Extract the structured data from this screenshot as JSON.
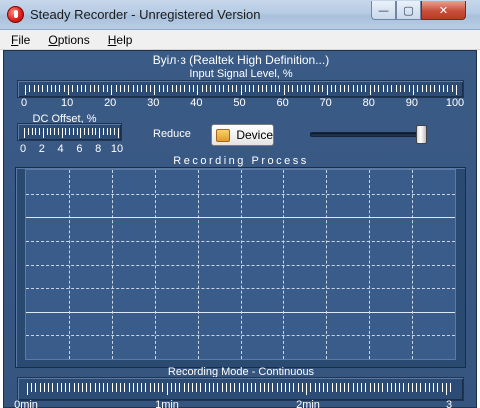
{
  "window": {
    "title": "Steady Recorder - Unregistered Version",
    "controls": {
      "minimize": "—",
      "maximize": "▢",
      "close": "✕"
    }
  },
  "menu": [
    "File",
    "Options",
    "Help"
  ],
  "device_label": "Вуiл·з (Realtek High Definition...)",
  "input_level": {
    "title": "Input Signal Level, %",
    "ticks": [
      "0",
      "10",
      "20",
      "30",
      "40",
      "50",
      "60",
      "70",
      "80",
      "90",
      "100"
    ]
  },
  "dc_offset": {
    "title": "DC Offset, %",
    "ticks": [
      "0",
      "2",
      "4",
      "6",
      "8",
      "10"
    ]
  },
  "reduce": {
    "label": "Reduce",
    "device_button": "Device",
    "slider_value": 1.0
  },
  "recording_process": {
    "title": "Recording Process"
  },
  "recording_mode": {
    "title": "Recording Mode - Continuous",
    "ticks": [
      "0min",
      "1min",
      "2min",
      "3"
    ]
  }
}
